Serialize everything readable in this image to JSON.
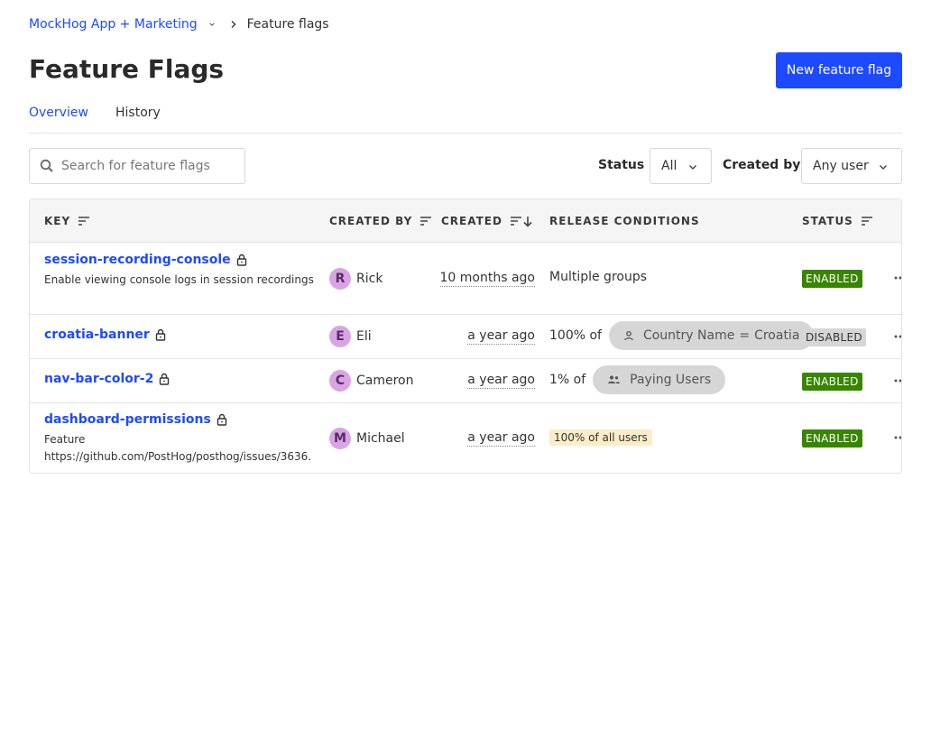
{
  "breadcrumb": {
    "project": "MockHog App + Marketing",
    "current": "Feature flags"
  },
  "header": {
    "title": "Feature Flags",
    "new_button": "New feature flag"
  },
  "tabs": [
    {
      "label": "Overview",
      "active": true
    },
    {
      "label": "History",
      "active": false
    }
  ],
  "filters": {
    "search_placeholder": "Search for feature flags",
    "status_label": "Status",
    "status_value": "All",
    "created_by_label": "Created by",
    "created_by_value": "Any user"
  },
  "table": {
    "columns": [
      "KEY",
      "CREATED BY",
      "CREATED",
      "RELEASE CONDITIONS",
      "STATUS"
    ],
    "rows": [
      {
        "key": "session-recording-console",
        "description": "Enable viewing console logs in session recordings",
        "creator_initial": "R",
        "creator": "Rick",
        "created": "10 months ago",
        "release": "Multiple groups",
        "status": "ENABLED"
      },
      {
        "key": "croatia-banner",
        "description": "",
        "creator_initial": "E",
        "creator": "Eli",
        "created": "a year ago",
        "release_prefix": "100% of",
        "release_pill_field": "Country Name",
        "release_pill_op": "=",
        "release_pill_value": "Croatia",
        "status": "DISABLED"
      },
      {
        "key": "nav-bar-color-2",
        "description": "",
        "creator_initial": "C",
        "creator": "Cameron",
        "created": "a year ago",
        "release_prefix": "1% of",
        "release_pill": "Paying Users",
        "status": "ENABLED"
      },
      {
        "key": "dashboard-permissions",
        "description_line1": "Feature",
        "description_line2": "https://github.com/PostHog/posthog/issues/3636.",
        "creator_initial": "M",
        "creator": "Michael",
        "created": "a year ago",
        "release_badge": "100% of all users",
        "status": "ENABLED"
      }
    ]
  },
  "colors": {
    "primary": "#1d4aff",
    "enabled": "#388600",
    "disabled": "#d6d6d6",
    "avatar": "#d9a4e4",
    "all_users_badge": "#faedc7"
  }
}
